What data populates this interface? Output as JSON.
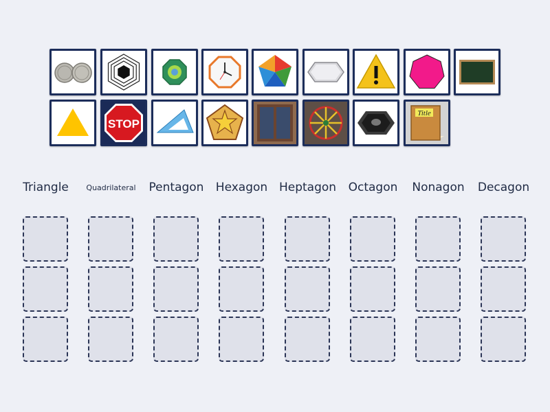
{
  "tiles": [
    {
      "name": "coins-tile",
      "icon": "coins-icon"
    },
    {
      "name": "concentric-hexagons-tile",
      "icon": "concentric-hexagons-icon"
    },
    {
      "name": "octagon-badge-tile",
      "icon": "octagon-badge-icon"
    },
    {
      "name": "octagon-clock-tile",
      "icon": "octagon-clock-icon"
    },
    {
      "name": "colorful-pentagon-tile",
      "icon": "colorful-pentagon-icon"
    },
    {
      "name": "silver-hexagon-tile",
      "icon": "silver-hexagon-icon"
    },
    {
      "name": "warning-sign-tile",
      "icon": "warning-sign-icon"
    },
    {
      "name": "pink-heptagon-tile",
      "icon": "pink-heptagon-icon"
    },
    {
      "name": "chalkboard-tile",
      "icon": "chalkboard-icon"
    },
    {
      "name": "yellow-triangle-tile",
      "icon": "yellow-triangle-icon"
    },
    {
      "name": "stop-sign-tile",
      "icon": "stop-sign-icon",
      "text": "STOP"
    },
    {
      "name": "set-square-tile",
      "icon": "set-square-icon"
    },
    {
      "name": "star-pentagon-tile",
      "icon": "star-pentagon-icon"
    },
    {
      "name": "window-tile",
      "icon": "window-icon"
    },
    {
      "name": "wheel-model-tile",
      "icon": "wheel-model-icon"
    },
    {
      "name": "hexagon-tray-tile",
      "icon": "hexagon-tray-icon"
    },
    {
      "name": "book-tile",
      "icon": "book-icon",
      "text": "Title"
    }
  ],
  "categories": [
    {
      "label": "Triangle"
    },
    {
      "label": "Quadrilateral"
    },
    {
      "label": "Pentagon"
    },
    {
      "label": "Hexagon"
    },
    {
      "label": "Heptagon"
    },
    {
      "label": "Octagon"
    },
    {
      "label": "Nonagon"
    },
    {
      "label": "Decagon"
    }
  ]
}
